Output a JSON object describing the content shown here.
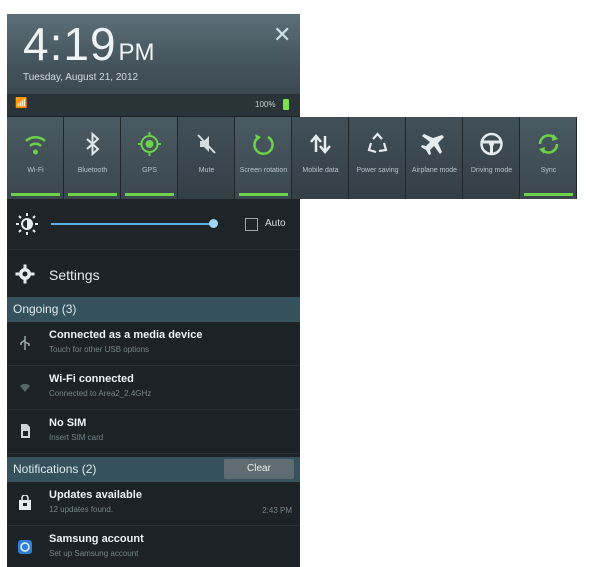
{
  "header": {
    "time": "4:19",
    "ampm": "PM",
    "date": "Tuesday, August 21, 2012",
    "close_icon": "close-icon"
  },
  "status": {
    "battery_text": "100%",
    "battery_color": "#7be04a"
  },
  "toggles": [
    {
      "label": "Wi-Fi",
      "icon": "wifi-icon",
      "on": true
    },
    {
      "label": "Bluetooth",
      "icon": "bluetooth-icon",
      "on": true
    },
    {
      "label": "GPS",
      "icon": "gps-icon",
      "on": true
    },
    {
      "label": "Mute",
      "icon": "mute-icon",
      "on": false
    },
    {
      "label": "Screen rotation",
      "icon": "rotation-icon",
      "on": true
    },
    {
      "label": "Mobile data",
      "icon": "mobile-data-icon",
      "on": false
    },
    {
      "label": "Power saving",
      "icon": "power-saving-icon",
      "on": false
    },
    {
      "label": "Airplane mode",
      "icon": "airplane-icon",
      "on": false
    },
    {
      "label": "Driving mode",
      "icon": "steering-wheel-icon",
      "on": false
    },
    {
      "label": "Sync",
      "icon": "sync-icon",
      "on": true
    }
  ],
  "accent_on": "#6bd24a",
  "brightness": {
    "auto_label": "Auto",
    "auto_checked": false,
    "level": 0.95
  },
  "settings": {
    "label": "Settings"
  },
  "ongoing": {
    "title": "Ongoing (3)",
    "items": [
      {
        "title": "Connected as a media device",
        "subtitle": "Touch for other USB options",
        "icon": "usb-icon"
      },
      {
        "title": "Wi-Fi connected",
        "subtitle": "Connected to Area2_2.4GHz",
        "icon": "wifi-icon"
      },
      {
        "title": "No SIM",
        "subtitle": "Insert SIM card",
        "icon": "sim-icon"
      }
    ]
  },
  "notifications": {
    "title": "Notifications (2)",
    "clear_label": "Clear",
    "items": [
      {
        "title": "Updates available",
        "subtitle": "12 updates found.",
        "time": "2:43 PM",
        "icon": "shopping-bag-icon"
      },
      {
        "title": "Samsung account",
        "subtitle": "Set up Samsung account",
        "time": "",
        "icon": "samsung-account-icon"
      }
    ]
  }
}
